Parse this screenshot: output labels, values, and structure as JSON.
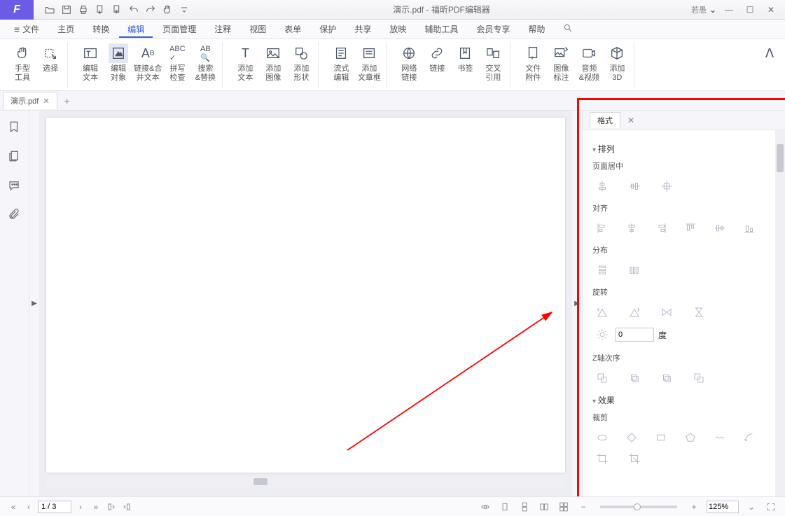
{
  "title": {
    "doc": "演示.pdf",
    "sep": " - ",
    "app": "福昕PDF编辑器",
    "user": "若愚"
  },
  "menus": {
    "file": "文件",
    "home": "主页",
    "convert": "转换",
    "edit": "编辑",
    "page": "页面管理",
    "comment": "注释",
    "view": "视图",
    "form": "表单",
    "protect": "保护",
    "share": "共享",
    "present": "放映",
    "assist": "辅助工具",
    "vip": "会员专享",
    "help": "帮助"
  },
  "ribbon": {
    "hand": "手型\n工具",
    "select": "选择",
    "edit_text": "编辑\n文本",
    "edit_obj": "编辑\n对象",
    "link_merge": "链接&合\n并文本",
    "spell": "拼写\n检查",
    "search": "搜索\n&替换",
    "add_text": "添加\n文本",
    "add_img": "添加\n图像",
    "add_shape": "添加\n形状",
    "flow_edit": "流式\n编辑",
    "add_para": "添加\n文章框",
    "weblink": "网络\n链接",
    "link": "链接",
    "bookmark": "书签",
    "xref": "交叉\n引用",
    "attach": "文件\n附件",
    "img_note": "图像\n标注",
    "av": "音频\n&视频",
    "add3d": "添加\n3D"
  },
  "doctab": {
    "name": "演示.pdf"
  },
  "panel": {
    "tab": "格式",
    "sect_arrange": "排列",
    "page_center": "页面居中",
    "align": "对齐",
    "distribute": "分布",
    "rotate": "旋转",
    "deg": "度",
    "zorder": "Z轴次序",
    "sect_effect": "效果",
    "crop": "裁剪",
    "rotate_value": "0"
  },
  "status": {
    "page": "1 / 3",
    "zoom": "125%"
  }
}
